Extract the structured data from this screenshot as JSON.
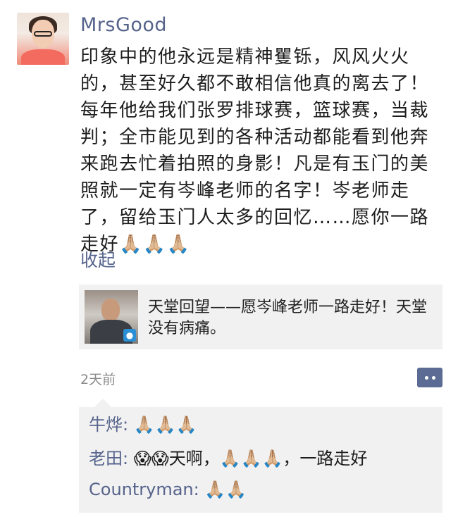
{
  "post": {
    "username": "MrsGood",
    "avatar_icon": "user-avatar",
    "text": "印象中的他永远是精神矍铄，风风火火的，甚至好久都不敢相信他真的离去了！每年他给我们张罗排球赛，篮球赛，当裁判；全市能见到的各种活动都能看到他奔来跑去忙着拍照的身影！凡是有玉门的美照就一定有岑峰老师的名字！岑老师走了，留给玉门人太多的回忆……愿你一路走好🙏🏼🙏🏼🙏🏼",
    "collapse_label": "收起"
  },
  "shared_article": {
    "title": "天堂回望——愿岑峰老师一路走好！天堂没有病痛。",
    "thumbnail_icon": "article-thumbnail"
  },
  "meta": {
    "timestamp": "2天前",
    "comment_icon": "comment-menu-icon"
  },
  "comments": [
    {
      "name": "牛烨",
      "text": "🙏🏼🙏🏼🙏🏼"
    },
    {
      "name": "老田",
      "text": "😱😱天啊，🙏🏼🙏🏼🙏🏼，一路走好"
    },
    {
      "name": "Countryman",
      "text": "🙏🏼🙏🏼"
    }
  ],
  "colors": {
    "name_link": "#56648c",
    "card_bg": "#f1f1f1",
    "comment_button": "#5b6b93"
  }
}
